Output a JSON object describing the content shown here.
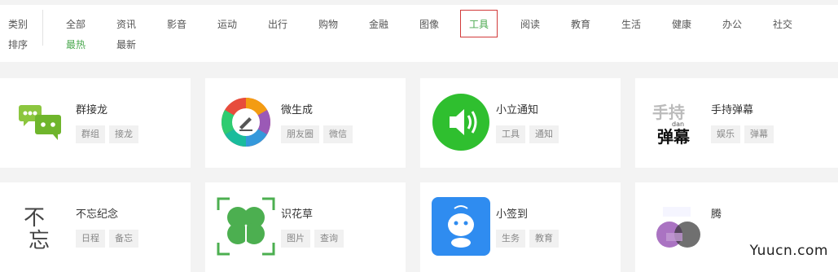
{
  "filter": {
    "category_label": "类别",
    "sort_label": "排序",
    "categories": [
      "全部",
      "资讯",
      "影音",
      "运动",
      "出行",
      "购物",
      "金融",
      "图像",
      "工具",
      "阅读",
      "教育",
      "生活",
      "健康",
      "办公",
      "社交"
    ],
    "active_category": "工具",
    "sorts": [
      "最热",
      "最新"
    ],
    "active_sort": "最热"
  },
  "apps": [
    {
      "name": "群接龙",
      "tags": [
        "群组",
        "接龙"
      ],
      "icon": "chat-bubbles-icon"
    },
    {
      "name": "微生成",
      "tags": [
        "朋友圈",
        "微信"
      ],
      "icon": "camera-aperture-icon"
    },
    {
      "name": "小立通知",
      "tags": [
        "工具",
        "通知"
      ],
      "icon": "speaker-icon"
    },
    {
      "name": "手持弹幕",
      "tags": [
        "娱乐",
        "弹幕"
      ],
      "icon": "danmu-logo-icon",
      "logo_text": [
        "手持",
        "dan",
        "弹幕"
      ]
    },
    {
      "name": "不忘纪念",
      "tags": [
        "日程",
        "备忘"
      ],
      "icon": "buwang-logo-icon",
      "logo_text": [
        "不",
        "忘"
      ]
    },
    {
      "name": "识花草",
      "tags": [
        "图片",
        "查询"
      ],
      "icon": "clover-icon"
    },
    {
      "name": "小签到",
      "tags": [
        "生务",
        "教育"
      ],
      "icon": "robot-icon"
    },
    {
      "name": "腾",
      "tags": [],
      "icon": "blurred-avatar-icon"
    }
  ],
  "watermark": "Yuucn.com",
  "colors": {
    "accent": "#4aa84f",
    "active_border": "#d23a3a",
    "speaker_green": "#2fbf2f",
    "robot_blue": "#2f8cf0"
  }
}
